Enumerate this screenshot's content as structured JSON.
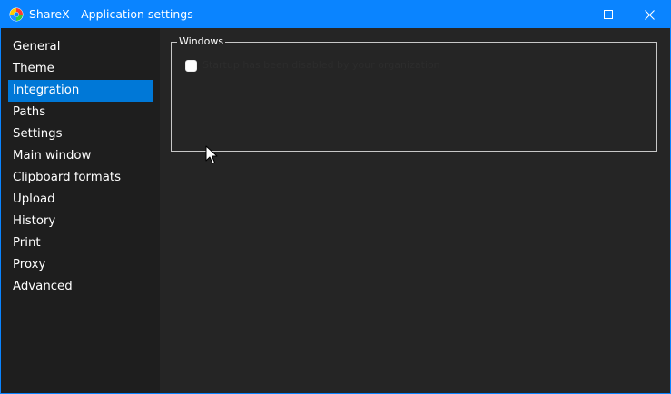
{
  "window": {
    "title": "ShareX - Application settings",
    "accent_color": "#0a84ff",
    "icons": {
      "app": "sharex-logo-icon",
      "minimize": "minimize-icon",
      "maximize": "maximize-icon",
      "close": "close-icon"
    }
  },
  "sidebar": {
    "selected_index": 2,
    "selected_color": "#0078d7",
    "items": [
      {
        "label": "General"
      },
      {
        "label": "Theme"
      },
      {
        "label": "Integration"
      },
      {
        "label": "Paths"
      },
      {
        "label": "Settings"
      },
      {
        "label": "Main window"
      },
      {
        "label": "Clipboard formats"
      },
      {
        "label": "Upload"
      },
      {
        "label": "History"
      },
      {
        "label": "Print"
      },
      {
        "label": "Proxy"
      },
      {
        "label": "Advanced"
      }
    ]
  },
  "integration": {
    "windows_group": {
      "title": "Windows",
      "startup_checkbox": {
        "label": "Startup has been disabled by your organization",
        "checked": false,
        "enabled": false
      }
    }
  }
}
